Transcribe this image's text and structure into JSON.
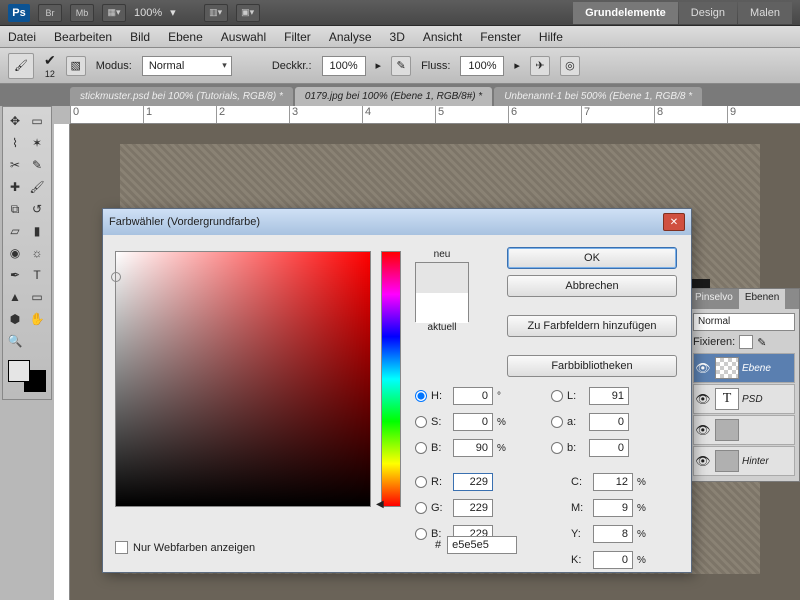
{
  "topbar": {
    "zoom": "100%"
  },
  "workspaces": [
    "Grundelemente",
    "Design",
    "Malen"
  ],
  "menu": [
    "Datei",
    "Bearbeiten",
    "Bild",
    "Ebene",
    "Auswahl",
    "Filter",
    "Analyse",
    "3D",
    "Ansicht",
    "Fenster",
    "Hilfe"
  ],
  "options": {
    "modus_label": "Modus:",
    "modus_value": "Normal",
    "deck_label": "Deckkr.:",
    "deck_value": "100%",
    "fluss_label": "Fluss:",
    "fluss_value": "100%"
  },
  "docs": [
    "stickmuster.psd bei 100% (Tutorials, RGB/8) *",
    "0179.jpg bei 100% (Ebene 1, RGB/8#) *",
    "Unbenannt-1 bei 500% (Ebene 1, RGB/8 *"
  ],
  "ruler": [
    "0",
    "1",
    "2",
    "3",
    "4",
    "5",
    "6",
    "7",
    "8",
    "9"
  ],
  "layers": {
    "tabs": [
      "Pinselvo",
      "Ebenen"
    ],
    "mode": "Normal",
    "fix": "Fixieren:",
    "rows": [
      {
        "name": "Ebene"
      },
      {
        "name": "PSD"
      },
      {
        "name": ""
      },
      {
        "name": "Hinter"
      }
    ]
  },
  "dialog": {
    "title": "Farbwähler (Vordergrundfarbe)",
    "neu": "neu",
    "aktuell": "aktuell",
    "ok": "OK",
    "cancel": "Abbrechen",
    "add": "Zu Farbfeldern hinzufügen",
    "libs": "Farbbibliotheken",
    "H": "0",
    "S": "0",
    "Bhsb": "90",
    "L": "91",
    "a": "0",
    "b": "0",
    "R": "229",
    "G": "229",
    "Bv": "229",
    "C": "12",
    "M": "9",
    "Y": "8",
    "K": "0",
    "hex": "e5e5e5",
    "webonly": "Nur Webfarben anzeigen",
    "deg": "°",
    "pct": "%",
    "lab": {
      "H": "H:",
      "S": "S:",
      "B": "B:",
      "R": "R:",
      "G": "G:",
      "Bv": "B:",
      "L": "L:",
      "a": "a:",
      "b": "b:",
      "C": "C:",
      "M": "M:",
      "Y": "Y:",
      "K": "K:",
      "hash": "#"
    }
  }
}
